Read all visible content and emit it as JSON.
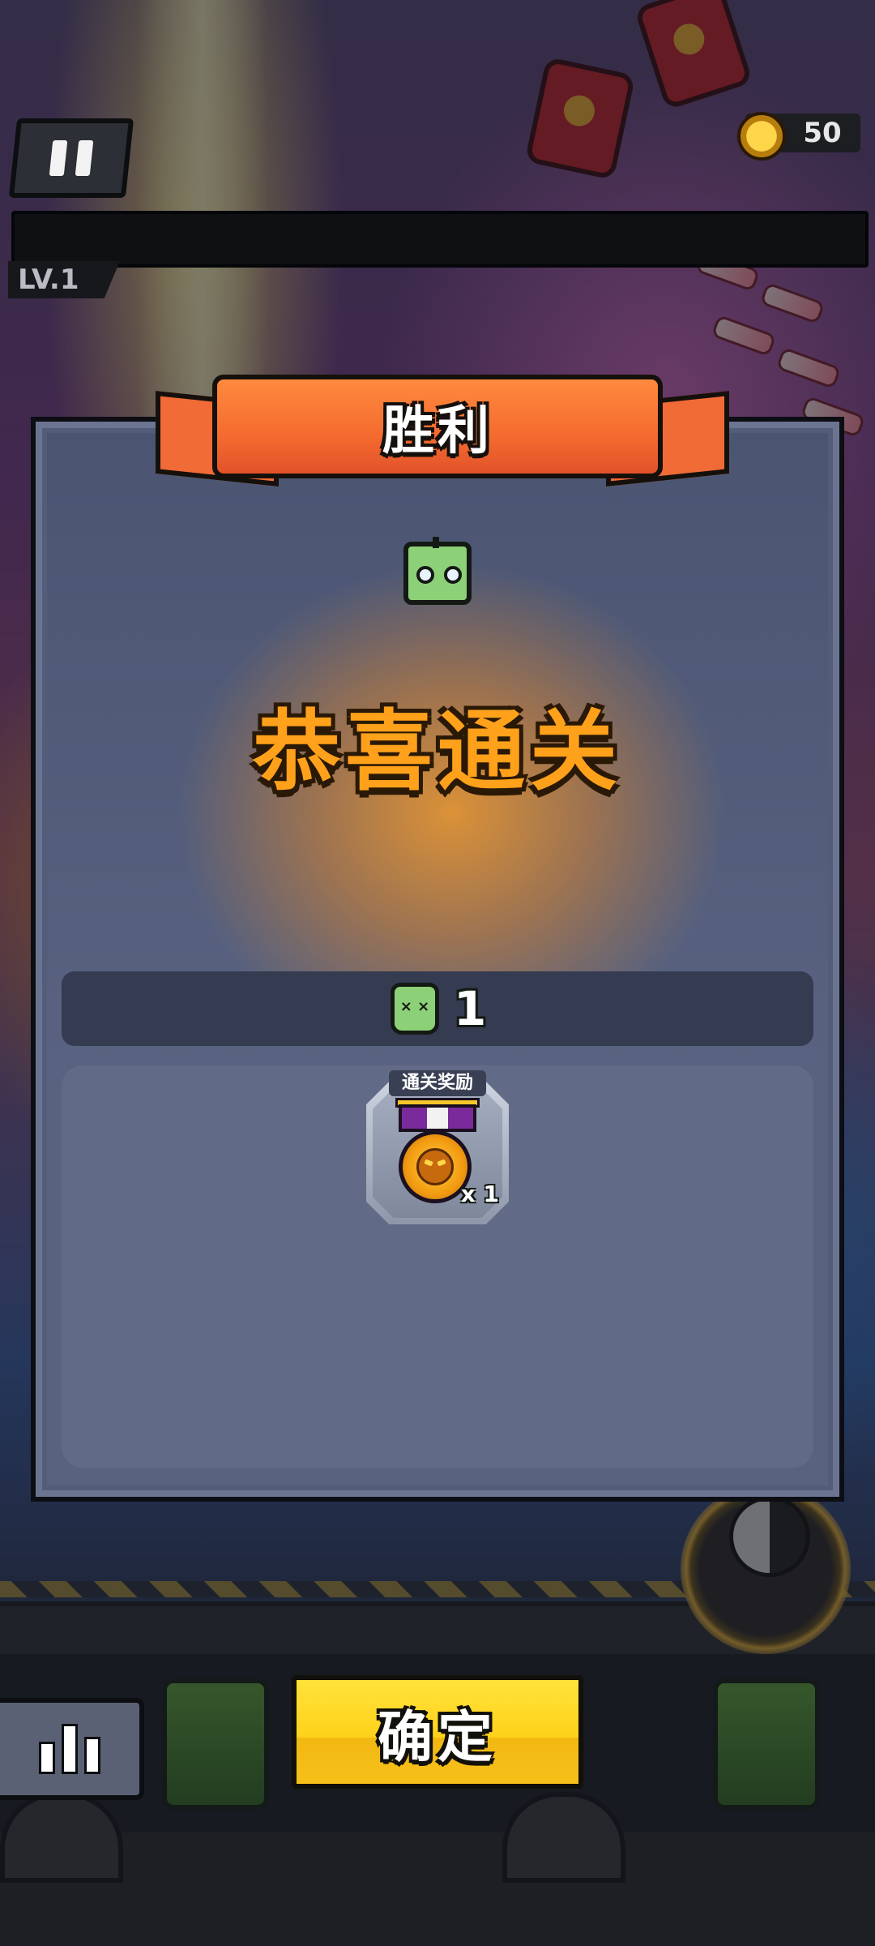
{
  "hud": {
    "coins": "50",
    "level": "LV.1"
  },
  "dialog": {
    "title": "胜利",
    "headline": "恭喜通关",
    "kill_count": "1",
    "reward_section_tag": "通关奖励",
    "reward_item_quantity": "x 1"
  },
  "buttons": {
    "confirm_label": "确定"
  },
  "icons": {
    "pause": "pause-icon",
    "coin": "coin-icon",
    "zombie": "zombie-head-icon",
    "zombie_kill": "zombie-kill-icon",
    "medal": "medal-icon",
    "stats": "bar-chart-icon"
  },
  "colors": {
    "ribbon": "#f46b2f",
    "headline": "#ffa11a",
    "confirm_button": "#ffd21a",
    "dialog_bg": "#535d79"
  }
}
